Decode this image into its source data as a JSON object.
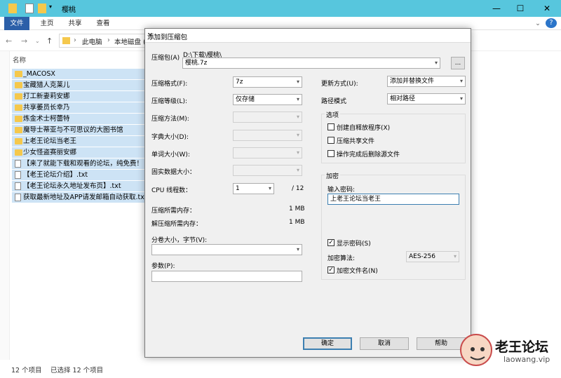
{
  "explorer": {
    "window_title": "樱桃",
    "ribbon_tabs": [
      "文件",
      "主页",
      "共享",
      "查看"
    ],
    "address_parts": [
      "此电脑",
      "本地磁盘 (D:)"
    ],
    "column_header": "名称",
    "files": [
      {
        "name": "_MACOSX",
        "type": "folder"
      },
      {
        "name": "宝藏猎人克莱儿",
        "type": "folder"
      },
      {
        "name": "打工新妻莉安娜",
        "type": "folder"
      },
      {
        "name": "共享萎员长幸乃",
        "type": "folder"
      },
      {
        "name": "炼金术士柯蕾特",
        "type": "folder"
      },
      {
        "name": "魔导士蒂亚与不可思议的大图书馆",
        "type": "folder"
      },
      {
        "name": "上老王论坛当老王",
        "type": "folder"
      },
      {
        "name": "少女怪盗赛丽安娜",
        "type": "folder"
      },
      {
        "name": "【来了就能下载和观看的论坛，纯免费！",
        "type": "file"
      },
      {
        "name": "【老王论坛介绍】.txt",
        "type": "file"
      },
      {
        "name": "【老王论坛永久地址发布页】.txt",
        "type": "file"
      },
      {
        "name": "获取最新地址及APP请发邮箱自动获取.txt",
        "type": "file"
      }
    ],
    "status_count": "12 个项目",
    "status_selected": "已选择 12 个项目"
  },
  "dialog": {
    "title": "添加到压缩包",
    "archive_label": "压缩包(A)",
    "archive_path": "D:\\下载\\樱桃\\",
    "archive_name": "樱桃.7z",
    "browse_label": "...",
    "format_label": "压缩格式(F):",
    "format_value": "7z",
    "level_label": "压缩等级(L):",
    "level_value": "仅存储",
    "method_label": "压缩方法(M):",
    "dict_label": "字典大小(D):",
    "word_label": "单词大小(W):",
    "solid_label": "固实数据大小：",
    "threads_label": "CPU 线程数：",
    "threads_value": "1",
    "threads_max": "/ 12",
    "mem_comp_label": "压缩所需内存：",
    "mem_comp_value": "1 MB",
    "mem_decomp_label": "解压缩所需内存：",
    "mem_decomp_value": "1 MB",
    "split_label": "分卷大小，字节(V):",
    "params_label": "参数(P):",
    "update_label": "更新方式(U):",
    "update_value": "添加并替换文件",
    "pathmode_label": "路径模式",
    "pathmode_value": "相对路径",
    "options_title": "选项",
    "opt_sfx": "创建自释放程序(X)",
    "opt_shared": "压缩共享文件",
    "opt_delete": "操作完成后删除源文件",
    "encrypt_title": "加密",
    "password_label": "输入密码:",
    "password_value": "上老王论坛当老王",
    "show_password": "显示密码(S)",
    "enc_method_label": "加密算法:",
    "enc_method_value": "AES-256",
    "enc_names": "加密文件名(N)",
    "ok": "确定",
    "cancel": "取消",
    "help": "帮助"
  },
  "watermark": {
    "text": "老王论坛",
    "url": "laowang.vip"
  }
}
